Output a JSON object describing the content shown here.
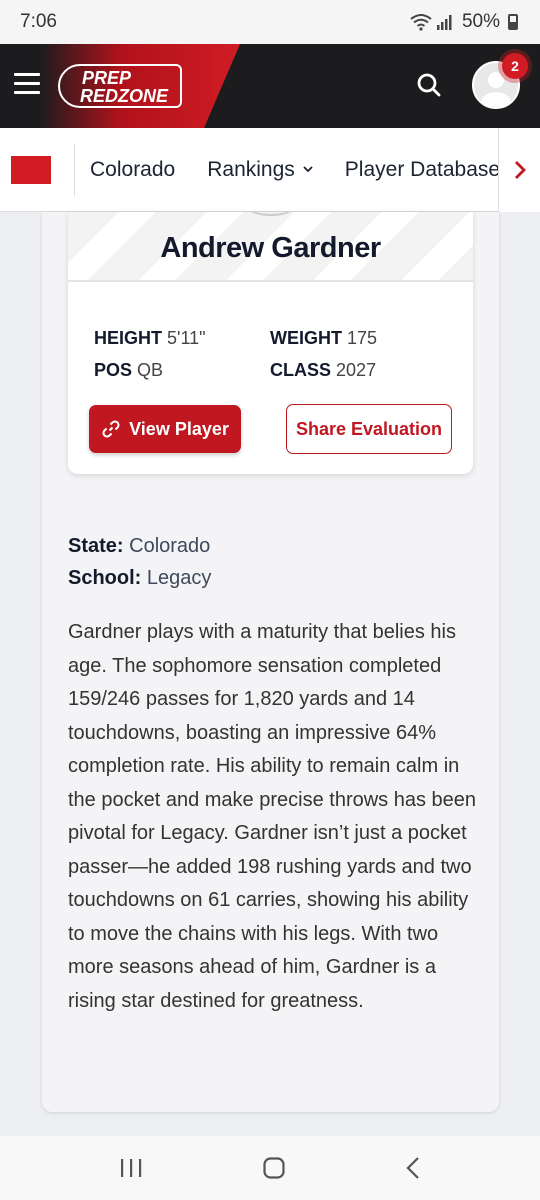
{
  "status_bar": {
    "time": "7:06",
    "battery": "50%"
  },
  "header": {
    "logo_line1": "PREP",
    "logo_line2": "REDZONE",
    "notification_count": "2"
  },
  "nav": {
    "items": [
      {
        "label": "Colorado"
      },
      {
        "label": "Rankings"
      },
      {
        "label": "Player Database"
      }
    ]
  },
  "player": {
    "name": "Andrew Gardner",
    "height_label": "HEIGHT",
    "height_value": "5'11\"",
    "weight_label": "WEIGHT",
    "weight_value": "175",
    "pos_label": "POS",
    "pos_value": "QB",
    "class_label": "CLASS",
    "class_value": "2027",
    "view_button": "View Player",
    "share_button": "Share Evaluation"
  },
  "info": {
    "state_label": "State:",
    "state_value": "Colorado",
    "school_label": "School:",
    "school_value": "Legacy"
  },
  "evaluation": "Gardner plays with a maturity that belies his age. The sophomore sensation completed 159/246 passes for 1,820 yards and 14 touchdowns, boasting an impressive 64% completion rate. His ability to remain calm in the pocket and make precise throws has been pivotal for Legacy. Gardner isn’t just a pocket passer—he added 198 rushing yards and two touchdowns on 61 carries, showing his ability to move the chains with his legs. With two more seasons ahead of him, Gardner is a rising star destined for greatness.",
  "colors": {
    "brand_red": "#c01721",
    "header_dark": "#1c1c1e"
  }
}
